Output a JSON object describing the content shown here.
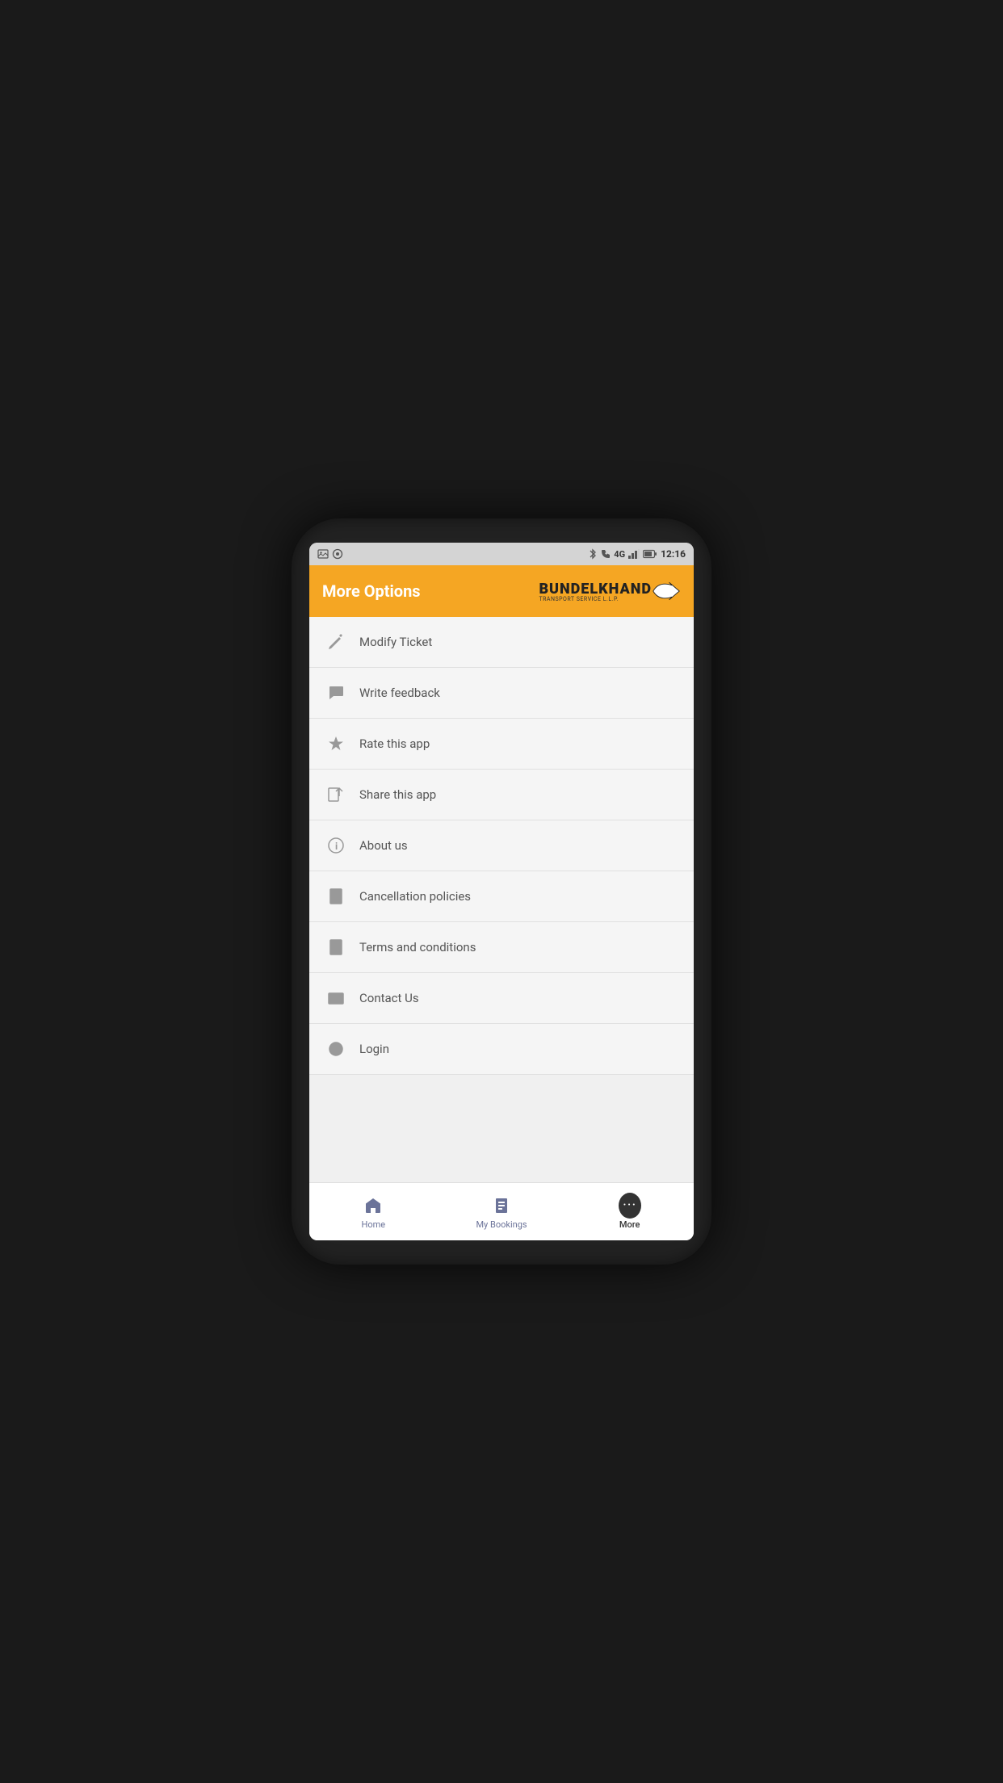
{
  "statusBar": {
    "time": "12:16",
    "network": "4G",
    "icons": [
      "bluetooth",
      "phone",
      "signal",
      "battery"
    ]
  },
  "header": {
    "title": "More Options",
    "brand": {
      "name": "BUNDELKHAND",
      "subtitle": "TRANSPORT SERVICE L.L.P."
    }
  },
  "menuItems": [
    {
      "id": "modify-ticket",
      "label": "Modify Ticket",
      "icon": "pencil"
    },
    {
      "id": "write-feedback",
      "label": "Write feedback",
      "icon": "chat"
    },
    {
      "id": "rate-app",
      "label": "Rate this app",
      "icon": "star"
    },
    {
      "id": "share-app",
      "label": "Share this app",
      "icon": "share"
    },
    {
      "id": "about-us",
      "label": "About us",
      "icon": "info"
    },
    {
      "id": "cancellation-policies",
      "label": "Cancellation policies",
      "icon": "cancel-doc"
    },
    {
      "id": "terms-conditions",
      "label": "Terms and conditions",
      "icon": "document"
    },
    {
      "id": "contact-us",
      "label": "Contact Us",
      "icon": "mail"
    },
    {
      "id": "login",
      "label": "Login",
      "icon": "power"
    }
  ],
  "bottomNav": [
    {
      "id": "home",
      "label": "Home",
      "active": false
    },
    {
      "id": "my-bookings",
      "label": "My Bookings",
      "active": false
    },
    {
      "id": "more",
      "label": "More",
      "active": true
    }
  ]
}
